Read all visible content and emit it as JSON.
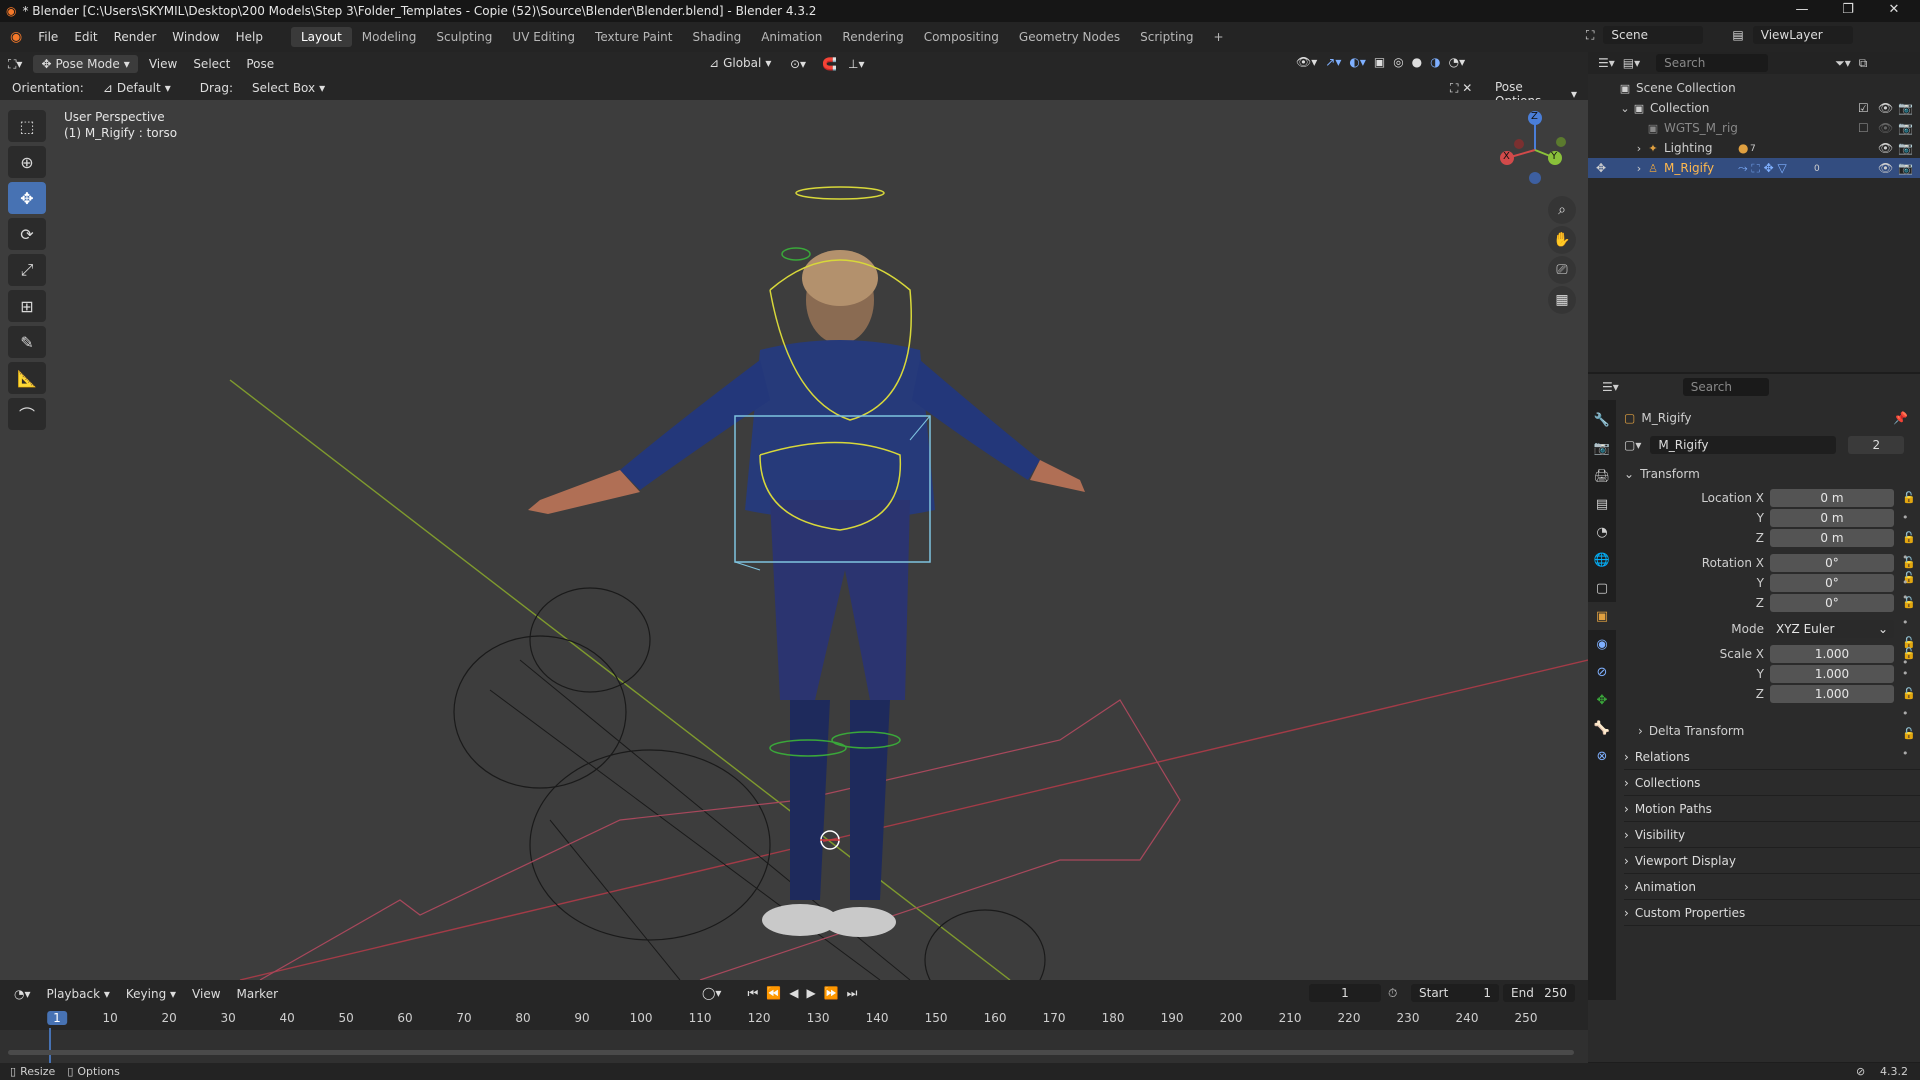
{
  "window": {
    "title": "* Blender [C:\\Users\\SKYMIL\\Desktop\\200 Models\\Step 3\\Folder_Templates - Copie (52)\\Source\\Blender\\Blender.blend] - Blender 4.3.2",
    "minimize": "—",
    "maximize": "❐",
    "close": "✕"
  },
  "menu": [
    "File",
    "Edit",
    "Render",
    "Window",
    "Help"
  ],
  "workspaces": [
    "Layout",
    "Modeling",
    "Sculpting",
    "UV Editing",
    "Texture Paint",
    "Shading",
    "Animation",
    "Rendering",
    "Compositing",
    "Geometry Nodes",
    "Scripting",
    "+"
  ],
  "active_workspace": "Layout",
  "scene": {
    "label": "Scene",
    "viewlayer": "ViewLayer"
  },
  "header": {
    "mode": "Pose Mode",
    "view": "View",
    "select": "Select",
    "pose": "Pose",
    "transform_orientation": "Global"
  },
  "tool_header": {
    "orientation_label": "Orientation:",
    "orientation_value": "Default",
    "drag_label": "Drag:",
    "drag_value": "Select Box",
    "pose_options": "Pose Options"
  },
  "viewport": {
    "perspective": "User Perspective",
    "object_info": "(1) M_Rigify : torso",
    "gizmo_axes": {
      "x": "X",
      "y": "Y",
      "z": "Z"
    }
  },
  "outliner": {
    "search_placeholder": "Search",
    "items": [
      {
        "label": "Scene Collection",
        "indent": 0
      },
      {
        "label": "Collection",
        "indent": 1
      },
      {
        "label": "WGTS_M_rig",
        "indent": 2
      },
      {
        "label": "Lighting",
        "indent": 2,
        "badge": "7"
      },
      {
        "label": "M_Rigify",
        "indent": 2,
        "badge": "0",
        "selected": true
      }
    ]
  },
  "properties": {
    "search_placeholder": "Search",
    "object_name": "M_Rigify",
    "datablock_name": "M_Rigify",
    "user_count": "2",
    "transform": {
      "title": "Transform",
      "location_label": "Location X",
      "location": [
        "0 m",
        "0 m",
        "0 m"
      ],
      "rotation_label": "Rotation X",
      "rotation": [
        "0°",
        "0°",
        "0°"
      ],
      "mode_label": "Mode",
      "mode": "XYZ Euler",
      "scale_label": "Scale X",
      "scale": [
        "1.000",
        "1.000",
        "1.000"
      ],
      "y": "Y",
      "z": "Z"
    },
    "subsections": [
      "Delta Transform"
    ],
    "sections": [
      "Relations",
      "Collections",
      "Motion Paths",
      "Visibility",
      "Viewport Display",
      "Animation",
      "Custom Properties"
    ]
  },
  "timeline": {
    "menus": [
      "Playback",
      "Keying",
      "View",
      "Marker"
    ],
    "current_frame": "1",
    "start_label": "Start",
    "start": "1",
    "end_label": "End",
    "end": "250",
    "ticks": [
      "1",
      "10",
      "20",
      "30",
      "40",
      "50",
      "60",
      "70",
      "80",
      "90",
      "100",
      "110",
      "120",
      "130",
      "140",
      "150",
      "160",
      "170",
      "180",
      "190",
      "200",
      "210",
      "220",
      "230",
      "240",
      "250"
    ]
  },
  "statusbar": {
    "left1": "Resize",
    "left2": "Options",
    "version": "4.3.2"
  },
  "colors": {
    "accent": "#4772b3",
    "viewport_bg": "#3d3d3d",
    "selected_row": "#334d80"
  }
}
